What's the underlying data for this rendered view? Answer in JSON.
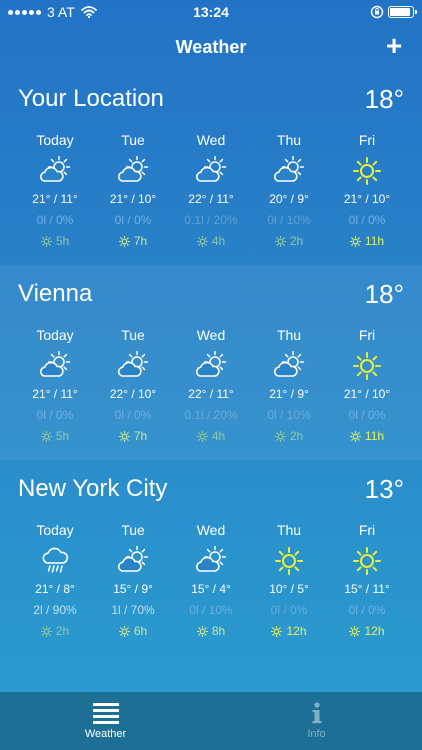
{
  "status": {
    "carrier": "3 AT",
    "time": "13:24",
    "battery_level": 0.9
  },
  "nav": {
    "title": "Weather",
    "add_label": "+"
  },
  "colors": {
    "precip_dim": "#6fb0e0",
    "precip_bright": "#bfe0f5",
    "sun_dim": "#8fc9a2",
    "sun_bright": "#e6f25a",
    "sun_icon": "#e8f23a"
  },
  "locations": [
    {
      "name": "Your Location",
      "temp": "18°",
      "days": [
        {
          "name": "Today",
          "icon": "partly-cloudy-icon",
          "temp": "21° / 11°",
          "precip": "0l / 0%",
          "sun": "5h",
          "precip_level": "dim",
          "sun_level": "dim"
        },
        {
          "name": "Tue",
          "icon": "partly-cloudy-icon",
          "temp": "21° / 10°",
          "precip": "0l / 0%",
          "sun": "7h",
          "precip_level": "dim",
          "sun_level": "mid"
        },
        {
          "name": "Wed",
          "icon": "partly-cloudy-icon",
          "temp": "22° / 11°",
          "precip": "0.1l / 20%",
          "sun": "4h",
          "precip_level": "faint",
          "sun_level": "dim"
        },
        {
          "name": "Thu",
          "icon": "partly-cloudy-icon",
          "temp": "20° / 9°",
          "precip": "0l / 10%",
          "sun": "2h",
          "precip_level": "faint",
          "sun_level": "dim"
        },
        {
          "name": "Fri",
          "icon": "sun-icon",
          "temp": "21° / 10°",
          "precip": "0l / 0%",
          "sun": "11h",
          "precip_level": "dim",
          "sun_level": "bright"
        }
      ]
    },
    {
      "name": "Vienna",
      "temp": "18°",
      "days": [
        {
          "name": "Today",
          "icon": "partly-cloudy-icon",
          "temp": "21° / 11°",
          "precip": "0l / 0%",
          "sun": "5h",
          "precip_level": "dim",
          "sun_level": "dim"
        },
        {
          "name": "Tue",
          "icon": "partly-cloudy-icon",
          "temp": "22° / 10°",
          "precip": "0l / 0%",
          "sun": "7h",
          "precip_level": "dim",
          "sun_level": "mid"
        },
        {
          "name": "Wed",
          "icon": "partly-cloudy-icon",
          "temp": "22° / 11°",
          "precip": "0.1l / 20%",
          "sun": "4h",
          "precip_level": "faint",
          "sun_level": "dim"
        },
        {
          "name": "Thu",
          "icon": "partly-cloudy-icon",
          "temp": "21° / 9°",
          "precip": "0l / 10%",
          "sun": "2h",
          "precip_level": "faint",
          "sun_level": "dim"
        },
        {
          "name": "Fri",
          "icon": "sun-icon",
          "temp": "21° / 10°",
          "precip": "0l / 0%",
          "sun": "11h",
          "precip_level": "dim",
          "sun_level": "bright"
        }
      ]
    },
    {
      "name": "New York City",
      "temp": "13°",
      "days": [
        {
          "name": "Today",
          "icon": "rain-icon",
          "temp": "21° / 8°",
          "precip": "2l / 90%",
          "sun": "2h",
          "precip_level": "bright",
          "sun_level": "dim"
        },
        {
          "name": "Tue",
          "icon": "partly-cloudy-icon",
          "temp": "15° / 9°",
          "precip": "1l / 70%",
          "sun": "6h",
          "precip_level": "bright",
          "sun_level": "mid"
        },
        {
          "name": "Wed",
          "icon": "partly-cloudy-icon",
          "temp": "15° / 4°",
          "precip": "0l / 10%",
          "sun": "8h",
          "precip_level": "dim",
          "sun_level": "mid"
        },
        {
          "name": "Thu",
          "icon": "sun-icon",
          "temp": "10° / 5°",
          "precip": "0l / 0%",
          "sun": "12h",
          "precip_level": "faint",
          "sun_level": "bright"
        },
        {
          "name": "Fri",
          "icon": "sun-icon",
          "temp": "15° / 11°",
          "precip": "0l / 0%",
          "sun": "12h",
          "precip_level": "dim",
          "sun_level": "bright"
        }
      ]
    }
  ],
  "tabs": [
    {
      "label": "Weather",
      "icon": "list-icon",
      "active": true
    },
    {
      "label": "Info",
      "icon": "info-icon",
      "active": false
    }
  ]
}
